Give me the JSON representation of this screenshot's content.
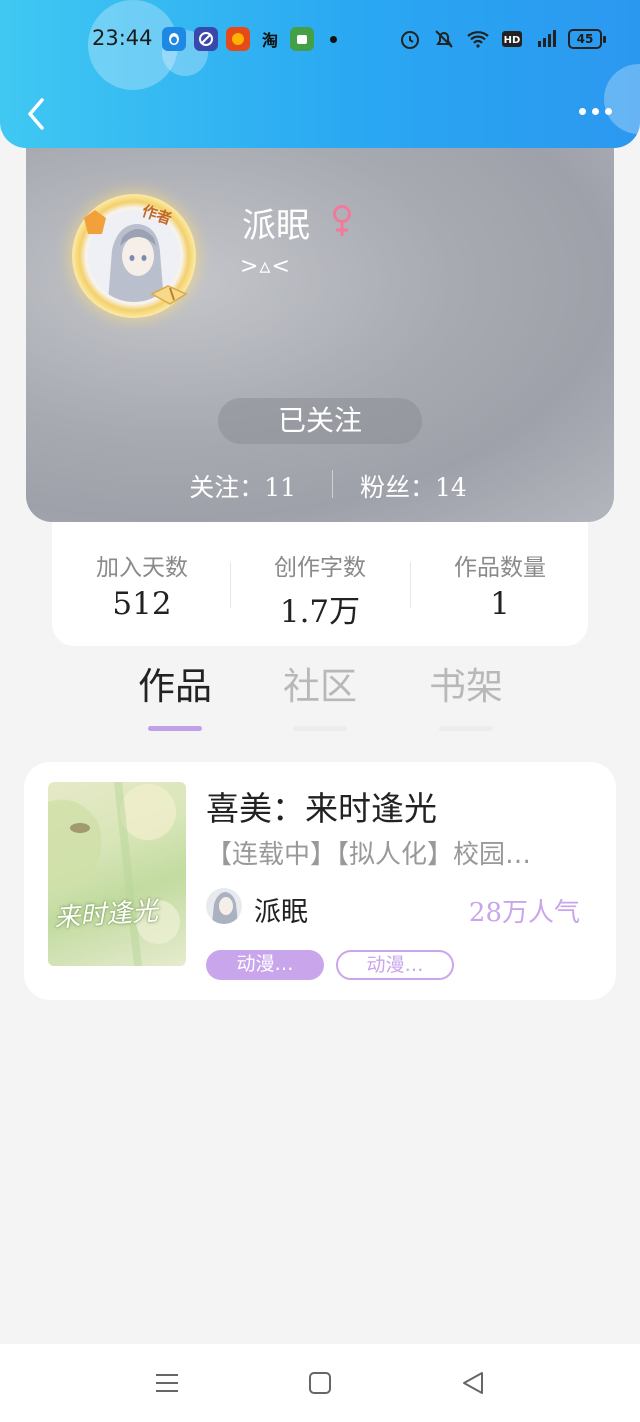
{
  "status_bar": {
    "time": "23:44",
    "app_icons": [
      "qq-icon",
      "browser-icon",
      "shopping-icon",
      "taobao-icon",
      "app-store-icon"
    ],
    "taobao_label": "淘",
    "battery": "45"
  },
  "nav": {
    "back": "back-icon",
    "more": "more-icon"
  },
  "profile": {
    "name": "派眠",
    "gender": "female",
    "signature": ">▵<",
    "author_tag": "作者",
    "follow_button": "已关注",
    "following": "关注：11",
    "followers": "粉丝：14"
  },
  "stats": [
    {
      "label": "加入天数",
      "value": "512"
    },
    {
      "label": "创作字数",
      "value": "1.7万"
    },
    {
      "label": "作品数量",
      "value": "1"
    }
  ],
  "tabs": [
    {
      "label": "作品",
      "active": true
    },
    {
      "label": "社区",
      "active": false
    },
    {
      "label": "书架",
      "active": false
    }
  ],
  "works": [
    {
      "title": "喜美：来时逢光",
      "description": "【连载中】【拟人化】校园…",
      "author": "派眠",
      "popularity": "28万人气",
      "cover_text": "来时逢光",
      "tags": [
        "动漫…",
        "动漫…"
      ]
    }
  ],
  "colors": {
    "header": "#2aa8f2",
    "accent": "#c9a6ec",
    "background": "#f4f4f4"
  }
}
